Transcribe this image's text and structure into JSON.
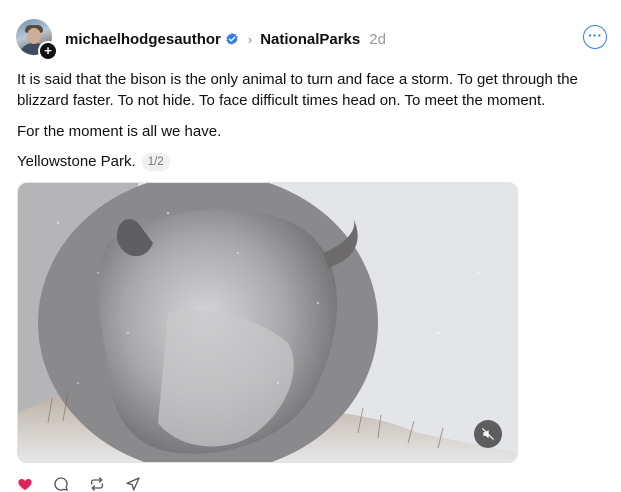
{
  "post": {
    "author": "michaelhodgesauthor",
    "community": "NationalParks",
    "timestamp": "2d",
    "paragraphs": [
      "It is said that the bison is the only animal to turn and face a storm. To get through the blizzard faster. To not hide. To face difficult times head on. To meet the moment.",
      "For the moment is all we have.",
      "Yellowstone Park."
    ],
    "media_counter": "1/2"
  },
  "icons": {
    "avatar": "avatar",
    "follow": "plus-icon",
    "verified": "verified-badge-icon",
    "separator": "chevron-right-icon",
    "more": "more-options-icon",
    "mute": "muted-speaker-icon",
    "like": "heart-icon",
    "reply": "comment-icon",
    "repost": "repost-icon",
    "share": "share-icon"
  },
  "glyphs": {
    "plus": "+",
    "chevron": "›",
    "ellipsis": "···"
  },
  "colors": {
    "accent": "#2f7ee8",
    "like": "#e0245e",
    "muted_text": "#999999"
  }
}
